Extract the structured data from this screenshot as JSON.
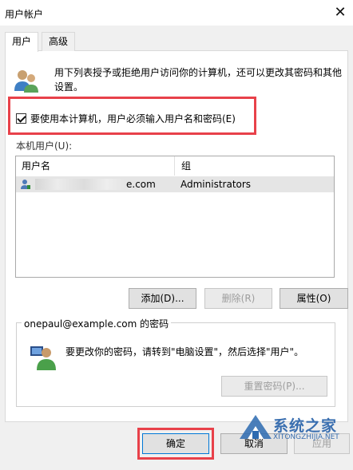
{
  "window": {
    "title": "用户帐户",
    "close_glyph": "✕"
  },
  "tabs": [
    {
      "label": "用户",
      "active": true
    },
    {
      "label": "高级",
      "active": false
    }
  ],
  "info": {
    "icon": "users-icon",
    "text": "用下列表授予或拒绝用户访问你的计算机，还可以更改其密码和其他设置。"
  },
  "require_login": {
    "label": "要使用本计算机，用户必须输入用户名和密码(E)",
    "checked": true
  },
  "users_section": {
    "label": "本机用户(U):",
    "columns": {
      "user": "用户名",
      "group": "组"
    },
    "rows": [
      {
        "user": "e.com",
        "group": "Administrators",
        "icon": "user-row-icon",
        "selected": true
      }
    ]
  },
  "buttons": {
    "add": "添加(D)...",
    "remove": "删除(R)",
    "properties": "属性(O)"
  },
  "password_group": {
    "title": "onepaul@example.com 的密码",
    "icon": "user-password-icon",
    "text": "要更改你的密码，请转到\"电脑设置\"，然后选择\"用户\"。",
    "reset_button": "重置密码(P)..."
  },
  "dialog_buttons": {
    "ok": "确定",
    "cancel": "取消",
    "apply": "应用"
  },
  "watermark": {
    "brand": "系统之家",
    "url": "XITONGZHIJIA.NET"
  },
  "colors": {
    "highlight": "#e8414a",
    "ok_border": "#0078d7",
    "watermark": "#3a6fb0"
  }
}
